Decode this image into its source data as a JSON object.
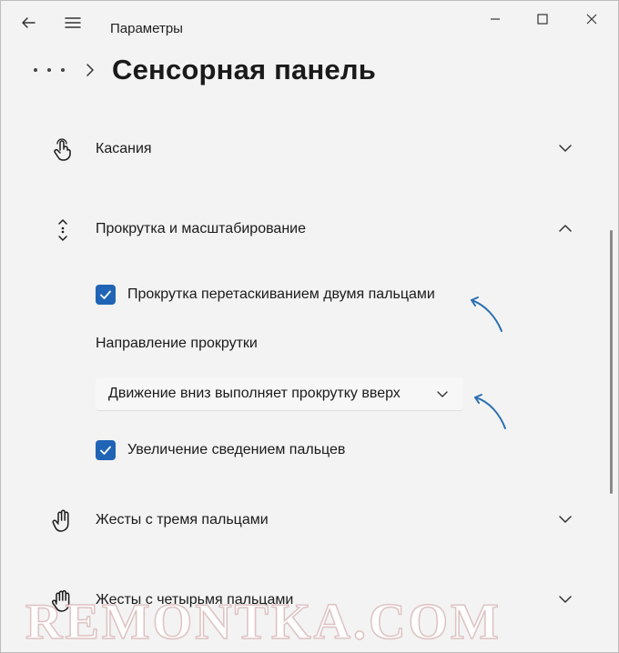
{
  "window": {
    "app_title": "Параметры"
  },
  "header": {
    "page_title": "Сенсорная панель"
  },
  "sections": {
    "taps": {
      "label": "Касания",
      "icon": "tap-hand-icon",
      "expanded": false
    },
    "scroll_zoom": {
      "label": "Прокрутка и масштабирование",
      "icon": "scroll-arrows-icon",
      "expanded": true
    },
    "three_finger": {
      "label": "Жесты с тремя пальцами",
      "icon": "hand-three-fingers-icon",
      "expanded": false
    },
    "four_finger": {
      "label": "Жесты с четырьмя пальцами",
      "icon": "hand-four-fingers-icon",
      "expanded": false
    }
  },
  "scroll_zoom": {
    "two_finger_drag": {
      "label": "Прокрутка перетаскиванием двумя пальцами",
      "checked": true
    },
    "scroll_direction_label": "Направление прокрутки",
    "scroll_direction_value": "Движение вниз выполняет прокрутку вверх",
    "pinch_zoom": {
      "label": "Увеличение сведением пальцев",
      "checked": true
    }
  },
  "colors": {
    "accent": "#1f64b5",
    "annotation_arrow": "#2a6fb0",
    "background": "#f3f3f3"
  },
  "watermark": "REMONTKA.COM"
}
